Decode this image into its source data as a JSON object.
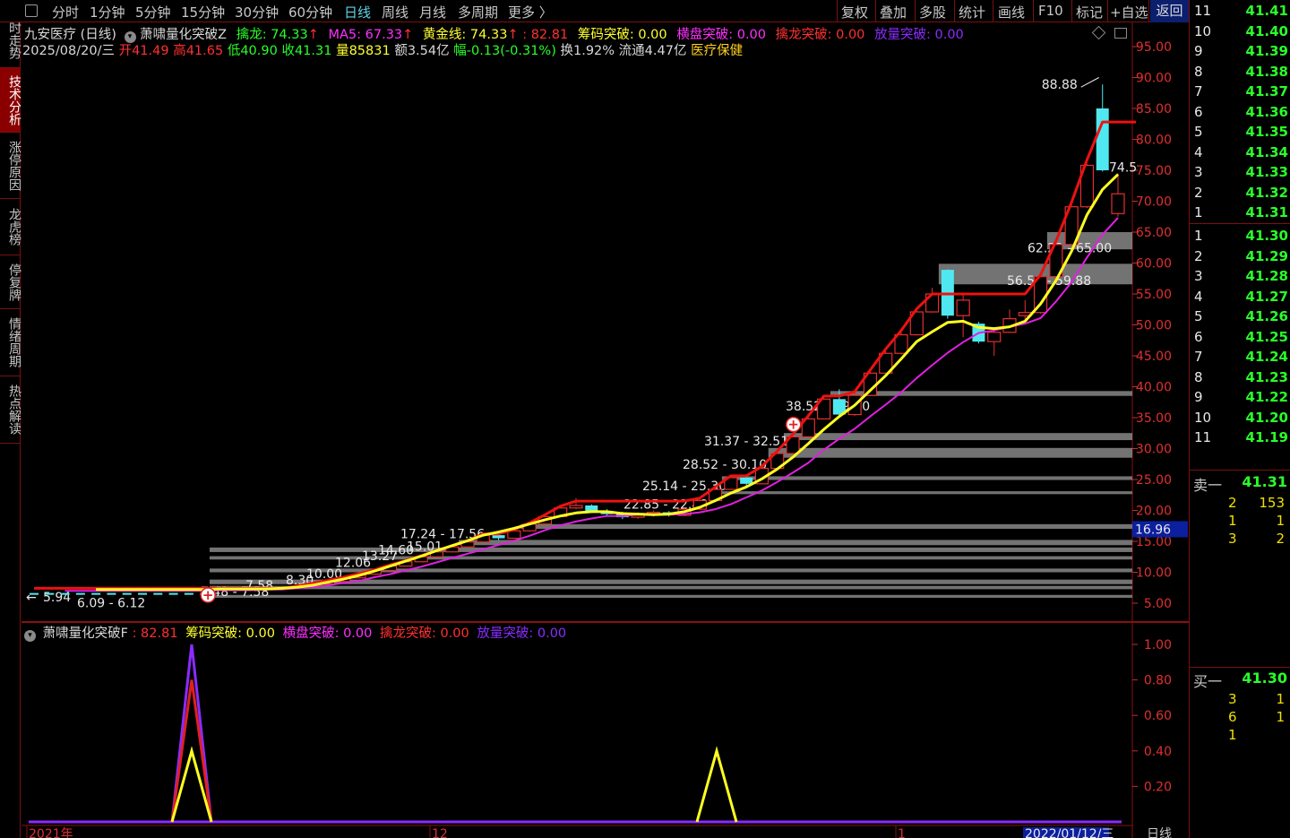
{
  "periods": [
    "分时",
    "1分钟",
    "5分钟",
    "15分钟",
    "30分钟",
    "60分钟",
    "日线",
    "周线",
    "月线",
    "多周期",
    "更多 〉"
  ],
  "active_period": "日线",
  "right_tools": [
    "复权",
    "叠加",
    "多股",
    "统计",
    "画线",
    "F10",
    "标记",
    "+自选"
  ],
  "back_label": "返回",
  "left_tabs": [
    "分时走势",
    "技术分析",
    "涨停原因",
    "龙虎榜",
    "停复牌",
    "情绪周期",
    "热点解读"
  ],
  "active_left_tab": "技术分析",
  "indicator_row": {
    "title": "九安医疗 (日线)",
    "indicator_name": "萧啸量化突破Z",
    "zhuolong": "擒龙: 74.33",
    "ma5": "MA5: 67.33",
    "huangjin": "黄金线: 74.33",
    "val": ": 82.81",
    "chouma": "筹码突破: 0.00",
    "hengpan": "横盘突破: 0.00",
    "qinlong": "擒龙突破: 0.00",
    "fangliang": "放量突破: 0.00"
  },
  "quote_row": {
    "date": "2025/08/20/三",
    "open": "开41.49",
    "high": "高41.65",
    "low": "低40.90",
    "close": "收41.31",
    "volume": "量85831",
    "amount": "额3.54亿",
    "change": "幅-0.13(-0.31%)",
    "turnover": "换1.92%",
    "float_cap": "流通4.47亿",
    "sector": "医疗保健"
  },
  "sub_indicator_row": {
    "name": "萧啸量化突破F",
    "val": ": 82.81",
    "chouma": "筹码突破: 0.00",
    "hengpan": "横盘突破: 0.00",
    "qinlong": "擒龙突破: 0.00",
    "fangliang": "放量突破: 0.00"
  },
  "colors": {
    "up": "#e23030",
    "down": "#50e8f0",
    "ma_red": "#ee1111",
    "ma_yellow": "#ffff20",
    "ma_magenta": "#e020e0",
    "green_text": "#28ff28",
    "yellow_text": "#ffff30",
    "magenta_text": "#ff30ff",
    "red_text": "#ff3030",
    "purple_text": "#8a2cff"
  },
  "chart_data": [
    {
      "type": "candlestick",
      "title": "",
      "y_ticks": [
        "95.00",
        "90.00",
        "85.00",
        "80.00",
        "75.00",
        "70.00",
        "65.00",
        "60.00",
        "55.00",
        "50.00",
        "45.00",
        "40.00",
        "35.00",
        "30.00",
        "25.00",
        "20.00",
        "15.00",
        "10.00",
        "5.00"
      ],
      "ylim": [
        2.0,
        99.0
      ],
      "current_price_marker": "16.96",
      "peak_label": "88.88",
      "last_label": "74.5",
      "zone_labels": [
        "62.22 - 65.00",
        "56.56 - 59.88",
        "38.52 - 39.30",
        "31.37 - 32.51",
        "28.52 - 30.10",
        "25.14 - 25.30",
        "22.85 - 22.88",
        "17.24 - 17.56",
        "15.01",
        "14.60",
        "13.27",
        "12.06",
        "10.00",
        "8.30",
        "7.58",
        "7.48",
        "6.09 - 6.12",
        "5.94"
      ],
      "zones": [
        [
          62.22,
          65.0
        ],
        [
          56.56,
          59.88
        ],
        [
          38.52,
          39.3
        ],
        [
          31.37,
          32.51
        ],
        [
          28.52,
          30.1
        ],
        [
          25.14,
          25.3
        ],
        [
          22.85,
          22.88
        ],
        [
          17.24,
          17.56
        ],
        [
          14.6,
          15.01
        ],
        [
          13.27,
          14.0
        ],
        [
          12.06,
          12.6
        ],
        [
          10.0,
          10.6
        ],
        [
          8.3,
          8.6
        ],
        [
          7.48,
          7.58
        ],
        [
          6.09,
          6.12
        ]
      ],
      "x_labels": [
        "2021年",
        "12",
        "1",
        "2022/01/12/三"
      ],
      "candles": [
        [
          7.6,
          7.7,
          7.4,
          7.5
        ],
        [
          7.5,
          7.6,
          7.3,
          7.4
        ],
        [
          7.4,
          7.5,
          7.2,
          7.3
        ],
        [
          7.3,
          7.5,
          7.2,
          7.4
        ],
        [
          7.4,
          7.6,
          7.3,
          7.5
        ],
        [
          7.5,
          7.8,
          7.4,
          7.7
        ],
        [
          7.7,
          8.2,
          7.6,
          8.1
        ],
        [
          8.1,
          8.6,
          8.0,
          8.5
        ],
        [
          8.5,
          9.2,
          8.4,
          9.1
        ],
        [
          9.1,
          9.8,
          9.0,
          9.7
        ],
        [
          9.7,
          10.4,
          9.6,
          10.3
        ],
        [
          10.3,
          11.1,
          10.2,
          11.0
        ],
        [
          11.0,
          11.8,
          10.9,
          11.7
        ],
        [
          11.7,
          12.6,
          11.6,
          12.5
        ],
        [
          12.5,
          13.4,
          12.4,
          13.3
        ],
        [
          13.3,
          14.2,
          13.2,
          14.1
        ],
        [
          14.1,
          15.0,
          14.0,
          14.9
        ],
        [
          14.9,
          16.2,
          14.8,
          16.0
        ],
        [
          16.0,
          16.4,
          15.2,
          15.5
        ],
        [
          15.5,
          16.8,
          15.4,
          16.7
        ],
        [
          16.7,
          17.9,
          16.6,
          17.8
        ],
        [
          17.8,
          19.2,
          17.7,
          19.0
        ],
        [
          19.0,
          20.6,
          18.9,
          20.4
        ],
        [
          20.4,
          22.0,
          20.2,
          20.8
        ],
        [
          20.8,
          21.0,
          19.6,
          19.9
        ],
        [
          19.9,
          20.2,
          19.1,
          19.4
        ],
        [
          19.4,
          19.8,
          18.6,
          18.9
        ],
        [
          18.9,
          19.7,
          18.6,
          19.5
        ],
        [
          19.5,
          20.0,
          19.0,
          19.7
        ],
        [
          19.7,
          19.9,
          19.0,
          19.2
        ],
        [
          19.2,
          20.4,
          19.1,
          20.2
        ],
        [
          20.2,
          21.8,
          20.1,
          21.6
        ],
        [
          21.6,
          23.6,
          21.5,
          23.4
        ],
        [
          23.4,
          25.5,
          23.3,
          25.3
        ],
        [
          25.3,
          25.6,
          23.8,
          24.3
        ],
        [
          24.3,
          27.0,
          24.2,
          26.8
        ],
        [
          26.8,
          29.4,
          26.7,
          29.2
        ],
        [
          29.2,
          32.1,
          29.1,
          31.9
        ],
        [
          31.9,
          35.0,
          31.8,
          34.8
        ],
        [
          34.8,
          38.2,
          34.7,
          38.0
        ],
        [
          38.0,
          39.6,
          35.0,
          35.5
        ],
        [
          35.5,
          39.0,
          35.3,
          38.6
        ],
        [
          38.6,
          42.5,
          38.5,
          42.2
        ],
        [
          42.2,
          45.8,
          42.0,
          45.4
        ],
        [
          45.4,
          49.0,
          45.2,
          48.4
        ],
        [
          48.4,
          52.7,
          48.3,
          52.1
        ],
        [
          52.1,
          56.0,
          52.0,
          55.0
        ],
        [
          58.9,
          59.0,
          51.0,
          51.5
        ],
        [
          51.5,
          55.0,
          48.0,
          54.0
        ],
        [
          50.2,
          50.5,
          47.0,
          47.3
        ],
        [
          47.3,
          49.0,
          45.0,
          48.8
        ],
        [
          48.8,
          52.5,
          48.7,
          51.0
        ],
        [
          51.5,
          54.0,
          50.8,
          52.0
        ],
        [
          52.0,
          58.5,
          51.8,
          57.8
        ],
        [
          57.8,
          63.5,
          57.6,
          63.0
        ],
        [
          63.0,
          69.3,
          62.8,
          69.1
        ],
        [
          69.1,
          76.0,
          68.9,
          75.8
        ],
        [
          85.0,
          88.88,
          74.8,
          75.0
        ],
        [
          68.0,
          74.5,
          67.5,
          71.2
        ]
      ],
      "series": [
        {
          "name": "擒龙",
          "values": [
            7.4,
            7.4,
            7.4,
            7.4,
            7.4,
            7.8,
            8.2,
            8.7,
            9.2,
            9.8,
            10.4,
            11.2,
            11.9,
            12.7,
            13.5,
            14.3,
            15.1,
            16.2,
            16.2,
            16.9,
            18.0,
            19.3,
            20.7,
            21.5,
            21.5,
            21.5,
            21.5,
            21.5,
            21.5,
            21.5,
            21.5,
            22.0,
            23.8,
            25.6,
            25.6,
            27.1,
            29.6,
            32.3,
            35.3,
            38.5,
            38.5,
            39.2,
            42.7,
            46.1,
            49.1,
            52.6,
            55.0,
            55.0,
            55.0,
            55.0,
            55.0,
            55.0,
            55.0,
            58.1,
            63.6,
            69.8,
            76.7,
            82.81,
            82.81
          ]
        },
        {
          "name": "MA5",
          "values": [
            7.1,
            7.1,
            7.1,
            7.2,
            7.2,
            7.4,
            7.6,
            7.9,
            8.3,
            8.6,
            9.2,
            9.7,
            10.3,
            10.9,
            11.6,
            12.3,
            13.0,
            13.7,
            14.4,
            15.1,
            15.9,
            16.8,
            17.6,
            18.2,
            18.7,
            19.1,
            19.1,
            19.3,
            19.3,
            19.3,
            19.4,
            19.7,
            20.2,
            21.0,
            22.1,
            23.2,
            24.6,
            26.1,
            27.7,
            29.8,
            31.6,
            33.2,
            35.2,
            37.1,
            39.1,
            41.4,
            43.5,
            45.5,
            47.2,
            48.7,
            49.1,
            49.7,
            50.2,
            51.1,
            53.8,
            56.9,
            60.9,
            64.6,
            67.33
          ]
        },
        {
          "name": "黄金线",
          "values": [
            7.3,
            7.3,
            7.3,
            7.3,
            7.4,
            7.6,
            7.9,
            8.4,
            8.9,
            9.5,
            10.2,
            11.0,
            11.8,
            12.6,
            13.5,
            14.3,
            15.1,
            16.0,
            16.5,
            17.1,
            17.8,
            18.5,
            19.1,
            19.6,
            19.8,
            19.8,
            19.5,
            19.4,
            19.3,
            19.4,
            19.8,
            20.5,
            21.6,
            22.8,
            23.8,
            25.1,
            26.7,
            28.6,
            30.8,
            33.1,
            35.2,
            37.0,
            39.4,
            41.8,
            44.5,
            47.3,
            48.9,
            50.4,
            50.6,
            49.6,
            49.4,
            49.7,
            50.6,
            53.4,
            57.2,
            61.9,
            67.8,
            71.9,
            74.33
          ]
        }
      ]
    },
    {
      "type": "line",
      "title": "",
      "y_ticks": [
        "1.00",
        "0.80",
        "0.60",
        "0.40",
        "0.20"
      ],
      "ylim": [
        0.0,
        1.02
      ],
      "series": [
        {
          "name": "萧啸量化突破F",
          "color": "#e02020",
          "spikes": [
            [
              8,
              0.8
            ]
          ]
        },
        {
          "name": "筹码突破",
          "color": "#ffff20",
          "spikes": [
            [
              8,
              0.4
            ],
            [
              34,
              0.4
            ]
          ]
        },
        {
          "name": "放量突破",
          "color": "#8a2cff",
          "spikes": [
            [
              8,
              1.0
            ]
          ]
        }
      ],
      "x_labels": [
        "2021年",
        "12",
        "1",
        "2022/01/12/三",
        "日线"
      ]
    }
  ],
  "orderbook": {
    "sell_levels": [
      {
        "lvl": "11",
        "px": "41.41"
      },
      {
        "lvl": "10",
        "px": "41.40"
      },
      {
        "lvl": "9",
        "px": "41.39"
      },
      {
        "lvl": "8",
        "px": "41.38"
      },
      {
        "lvl": "7",
        "px": "41.37"
      },
      {
        "lvl": "6",
        "px": "41.36"
      },
      {
        "lvl": "5",
        "px": "41.35"
      },
      {
        "lvl": "4",
        "px": "41.34"
      },
      {
        "lvl": "3",
        "px": "41.33"
      },
      {
        "lvl": "2",
        "px": "41.32"
      },
      {
        "lvl": "1",
        "px": "41.31"
      }
    ],
    "buy_levels": [
      {
        "lvl": "1",
        "px": "41.30"
      },
      {
        "lvl": "2",
        "px": "41.29"
      },
      {
        "lvl": "3",
        "px": "41.28"
      },
      {
        "lvl": "4",
        "px": "41.27"
      },
      {
        "lvl": "5",
        "px": "41.26"
      },
      {
        "lvl": "6",
        "px": "41.25"
      },
      {
        "lvl": "7",
        "px": "41.24"
      },
      {
        "lvl": "8",
        "px": "41.23"
      },
      {
        "lvl": "9",
        "px": "41.22"
      },
      {
        "lvl": "10",
        "px": "41.20"
      },
      {
        "lvl": "11",
        "px": "41.19"
      }
    ],
    "sell_one_label": "卖一",
    "sell_one_px": "41.31",
    "sell_qty": [
      [
        "2",
        "153"
      ],
      [
        "1",
        "1"
      ],
      [
        "3",
        "2"
      ]
    ],
    "buy_one_label": "买一",
    "buy_one_px": "41.30",
    "buy_qty": [
      [
        "3",
        "1"
      ],
      [
        "6",
        "1"
      ],
      [
        "1",
        ""
      ]
    ]
  }
}
